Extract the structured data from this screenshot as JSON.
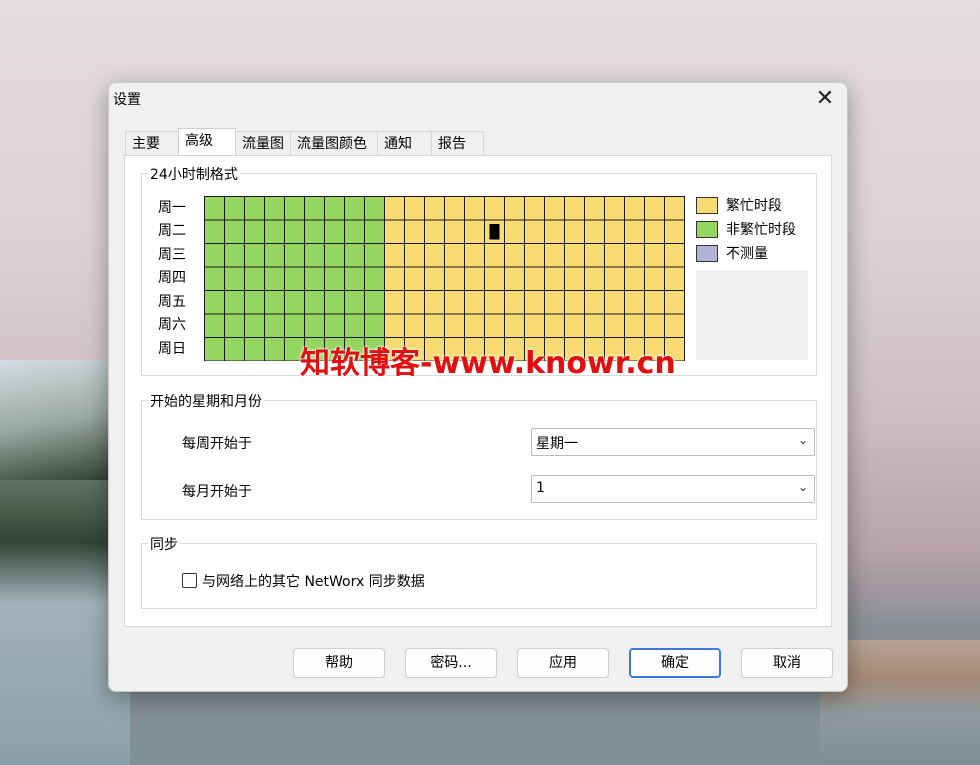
{
  "window": {
    "title": "设置",
    "close_glyph": "✕"
  },
  "tabs": [
    {
      "label": "主要"
    },
    {
      "label": "高级"
    },
    {
      "label": "流量图"
    },
    {
      "label": "流量图颜色"
    },
    {
      "label": "通知"
    },
    {
      "label": "报告"
    }
  ],
  "active_tab": "高级",
  "schedule": {
    "title": "24小时制格式",
    "days": [
      "周一",
      "周二",
      "周三",
      "周四",
      "周五",
      "周六",
      "周日"
    ],
    "hours_per_day": 24,
    "green_hours_per_day": 9,
    "selected_cell": {
      "day": "周二",
      "hour": 14
    },
    "legend": [
      {
        "label": "繁忙时段",
        "color": "#f8dc73"
      },
      {
        "label": "非繁忙时段",
        "color": "#95d660"
      },
      {
        "label": "不测量",
        "color": "#b3b3d9"
      }
    ]
  },
  "week_month": {
    "title": "开始的星期和月份",
    "week_label": "每周开始于",
    "week_value": "星期一",
    "month_label": "每月开始于",
    "month_value": "1"
  },
  "sync": {
    "title": "同步",
    "checkbox_label": "与网络上的其它 NetWorx 同步数据",
    "checked": false
  },
  "buttons": {
    "help": "帮助",
    "password": "密码...",
    "apply": "应用",
    "ok": "确定",
    "cancel": "取消"
  },
  "watermark": "知软博客-www.knowr.cn",
  "colors": {
    "accent": "#3b78d8",
    "busy": "#f8dc73",
    "offpeak": "#95d660",
    "unmetered": "#b3b3d9"
  }
}
